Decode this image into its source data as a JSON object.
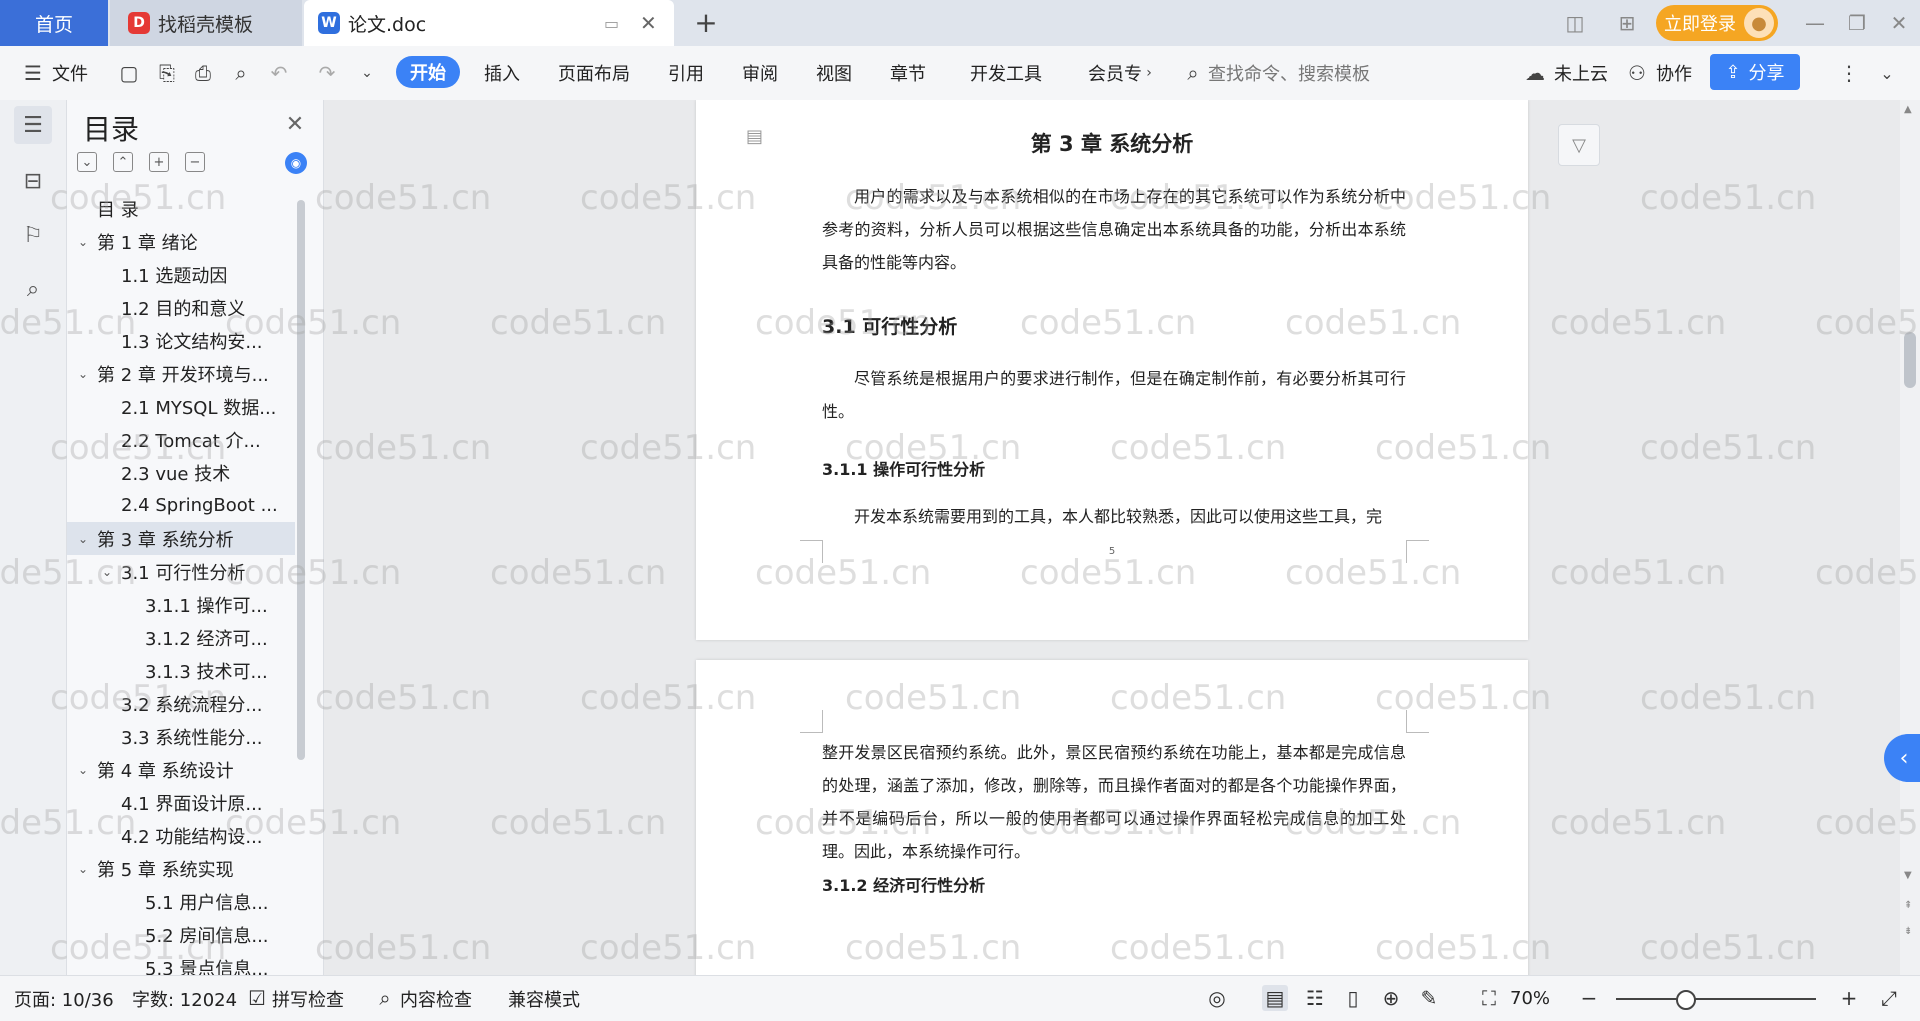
{
  "tabs": {
    "home": "首页",
    "template": "找稻壳模板",
    "doc": "论文.doc"
  },
  "title_bar": {
    "login": "立即登录"
  },
  "toolbar": {
    "file": "文件",
    "start": "开始",
    "insert": "插入",
    "layout": "页面布局",
    "reference": "引用",
    "review": "审阅",
    "view": "视图",
    "chapter": "章节",
    "devtools": "开发工具",
    "member": "会员专",
    "search_placeholder": "查找命令、搜索模板",
    "cloud": "未上云",
    "collab": "协作",
    "share": "分享"
  },
  "toc": {
    "title": "目录",
    "items": [
      {
        "label": "目  录",
        "level": 0,
        "arrow": ""
      },
      {
        "label": "第 1 章  绪论",
        "level": 0,
        "arrow": "v"
      },
      {
        "label": "1.1 选题动因",
        "level": 1,
        "arrow": ""
      },
      {
        "label": "1.2 目的和意义",
        "level": 1,
        "arrow": ""
      },
      {
        "label": "1.3 论文结构安...",
        "level": 1,
        "arrow": ""
      },
      {
        "label": "第 2 章  开发环境与...",
        "level": 0,
        "arrow": "v"
      },
      {
        "label": "2.1 MYSQL 数据...",
        "level": 1,
        "arrow": ""
      },
      {
        "label": "2.2 Tomcat 介...",
        "level": 1,
        "arrow": ""
      },
      {
        "label": "2.3 vue 技术",
        "level": 1,
        "arrow": ""
      },
      {
        "label": "2.4 SpringBoot ...",
        "level": 1,
        "arrow": ""
      },
      {
        "label": "第 3 章  系统分析",
        "level": 0,
        "arrow": "v",
        "selected": true
      },
      {
        "label": "3.1 可行性分析",
        "level": 1,
        "arrow": "v"
      },
      {
        "label": "3.1.1 操作可...",
        "level": 2,
        "arrow": ""
      },
      {
        "label": "3.1.2 经济可...",
        "level": 2,
        "arrow": ""
      },
      {
        "label": "3.1.3 技术可...",
        "level": 2,
        "arrow": ""
      },
      {
        "label": "3.2 系统流程分...",
        "level": 1,
        "arrow": ""
      },
      {
        "label": "3.3 系统性能分...",
        "level": 1,
        "arrow": ""
      },
      {
        "label": "第 4 章  系统设计",
        "level": 0,
        "arrow": "v"
      },
      {
        "label": "4.1 界面设计原...",
        "level": 1,
        "arrow": ""
      },
      {
        "label": "4.2 功能结构设...",
        "level": 1,
        "arrow": ""
      },
      {
        "label": "第 5 章  系统实现",
        "level": 0,
        "arrow": "v"
      },
      {
        "label": "5.1 用户信息...",
        "level": 2,
        "arrow": ""
      },
      {
        "label": "5.2 房间信息...",
        "level": 2,
        "arrow": ""
      },
      {
        "label": "5.3 景点信息...",
        "level": 2,
        "arrow": ""
      }
    ]
  },
  "doc": {
    "page1": {
      "chapter_title": "第 3 章  系统分析",
      "intro": "用户的需求以及与本系统相似的在市场上存在的其它系统可以作为系统分析中参考的资料，分析人员可以根据这些信息确定出本系统具备的功能，分析出本系统具备的性能等内容。",
      "h_31": "3.1 可行性分析",
      "p_31": "尽管系统是根据用户的要求进行制作，但是在确定制作前，有必要分析其可行性。",
      "h_311": "3.1.1 操作可行性分析",
      "p_311": "开发本系统需要用到的工具，本人都比较熟悉，因此可以使用这些工具，完",
      "page_number": "5"
    },
    "page2": {
      "p_cont": "整开发景区民宿预约系统。此外，景区民宿预约系统在功能上，基本都是完成信息的处理，涵盖了添加，修改，删除等，而且操作者面对的都是各个功能操作界面，并不是编码后台，所以一般的使用者都可以通过操作界面轻松完成信息的加工处理。因此，本系统操作可行。",
      "h_312": "3.1.2 经济可行性分析"
    }
  },
  "status": {
    "page": "页面: 10/36",
    "words": "字数: 12024",
    "spell": "拼写检查",
    "content_check": "内容检查",
    "compat": "兼容模式",
    "zoom": "70%"
  },
  "watermark": "code51.cn",
  "colors": {
    "accent": "#3b82f6",
    "home_tab": "#3b6fd8",
    "login": "#f5a623"
  }
}
